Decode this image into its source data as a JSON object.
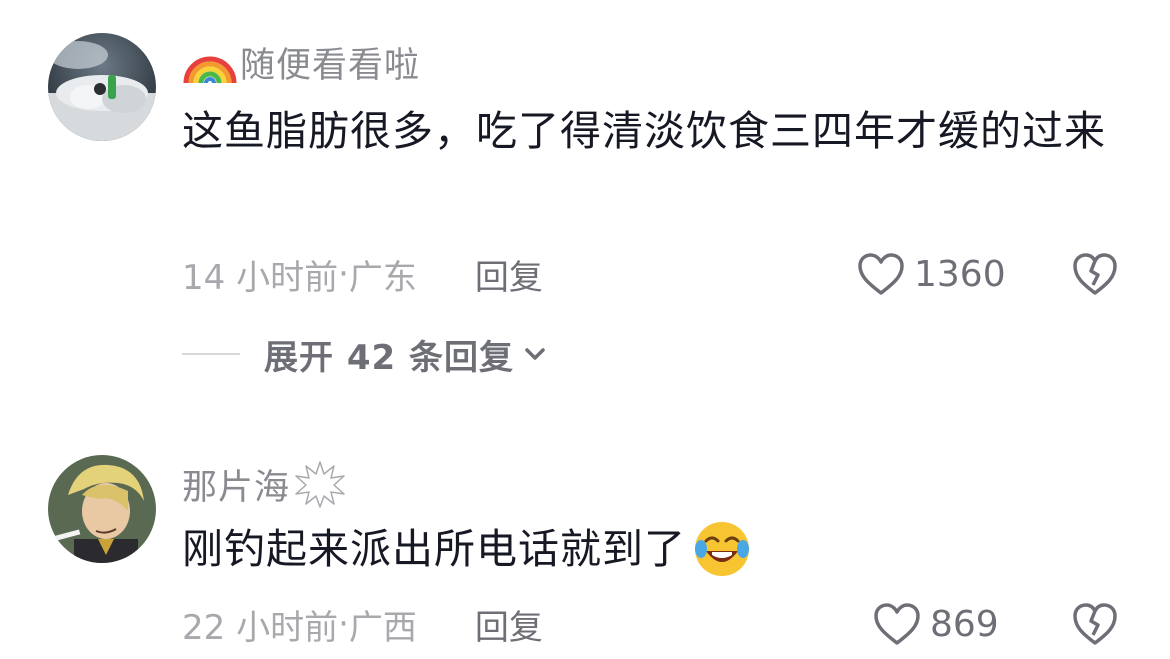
{
  "comments": [
    {
      "username": "随便看看啦",
      "text": "这鱼脂肪很多，吃了得清淡饮食三四年才缓的过来",
      "time": "14 小时前",
      "location": "广东",
      "reply_label": "回复",
      "likes": "1360",
      "avatar_icon": "astronaut-avatar",
      "name_badge_icon": "rainbow-icon"
    },
    {
      "username": "那片海",
      "text": "刚钓起来派出所电话就到了",
      "time": "22 小时前",
      "location": "广西",
      "reply_label": "回复",
      "likes": "869",
      "avatar_icon": "anime-character-avatar",
      "name_badge_icon": "burst-icon",
      "text_emoji_icon": "crying-laughing-emoji"
    }
  ],
  "expand_replies": {
    "label": "展开 42 条回复"
  },
  "meta_separator": " · ",
  "colors": {
    "primary_text": "#161823",
    "secondary_text": "#8a8b91",
    "meta_text": "#a8a9ad"
  }
}
